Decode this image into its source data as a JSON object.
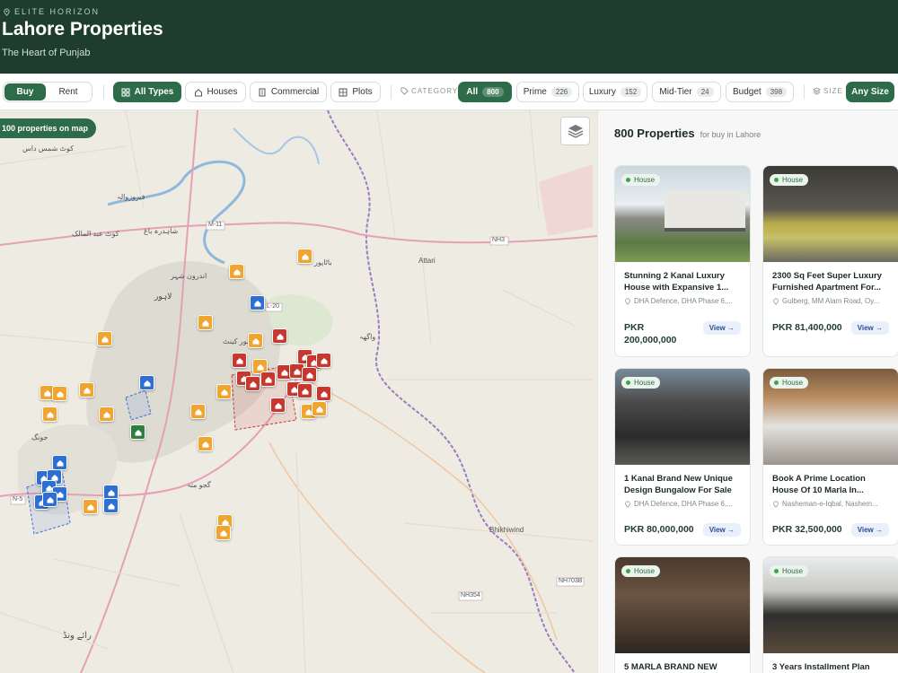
{
  "header": {
    "brand": "ELITE HORIZON",
    "title": "Lahore Properties",
    "subtitle": "The Heart of Punjab",
    "bg_color": "#1f3d2e"
  },
  "filters": {
    "mode": {
      "buy": "Buy",
      "rent": "Rent",
      "selected": "Buy"
    },
    "types": [
      "All Types",
      "Houses",
      "Commercial",
      "Plots"
    ],
    "selected_type": "All Types",
    "category_label": "CATEGORY",
    "categories": [
      {
        "label": "All",
        "count": "800"
      },
      {
        "label": "Prime",
        "count": "226"
      },
      {
        "label": "Luxury",
        "count": "152"
      },
      {
        "label": "Mid-Tier",
        "count": "24"
      },
      {
        "label": "Budget",
        "count": "398"
      }
    ],
    "selected_category": "All",
    "size_label": "SIZE",
    "size_value": "Any Size"
  },
  "map": {
    "count_tag": "100 properties on map",
    "places": [
      "کوٹ شمس داس",
      "فیروزوالہ",
      "کوٹ عبد المالک",
      "شاہدرہ باغ",
      "اندرون شہر",
      "لاہور",
      "لاہور کینٹ",
      "جونگ",
      "گجو متہ",
      "رائے ونڈ",
      "واگھہ",
      "باٹاپور",
      "Attari",
      "Bhikhiwind",
      "M-11",
      "N-5",
      "NH3",
      "NH354",
      "NH703B",
      "L-20"
    ],
    "pin_colors": {
      "orange": "#f0a531",
      "blue": "#2e6fd3",
      "red": "#c8372d",
      "green": "#2f7d3f"
    }
  },
  "listing": {
    "count": "800 Properties",
    "subtitle": "for buy in Lahore",
    "cards": [
      {
        "badge": "House",
        "title": "Stunning 2 Kanal Luxury House with Expansive 1...",
        "location": "DHA Defence, DHA Phase 6,...",
        "price": "PKR 200,000,000",
        "view": "View →"
      },
      {
        "badge": "House",
        "title": "2300 Sq Feet Super Luxury Furnished Apartment For...",
        "location": "Gulberg, MM Alam Road, Oy...",
        "price": "PKR 81,400,000",
        "view": "View →"
      },
      {
        "badge": "House",
        "title": "1 Kanal Brand New Unique Design Bungalow For Sale ...",
        "location": "DHA Defence, DHA Phase 6,...",
        "price": "PKR 80,000,000",
        "view": "View →"
      },
      {
        "badge": "House",
        "title": "Book A Prime Location House Of 10 Marla In...",
        "location": "Nasheman-e-Iqbal, Nashem...",
        "price": "PKR 32,500,000",
        "view": "View →"
      },
      {
        "badge": "House",
        "title": "5 MARLA BRAND NEW",
        "location": "",
        "price": "",
        "view": ""
      },
      {
        "badge": "House",
        "title": "3 Years Installment Plan",
        "location": "",
        "price": "",
        "view": ""
      }
    ]
  }
}
